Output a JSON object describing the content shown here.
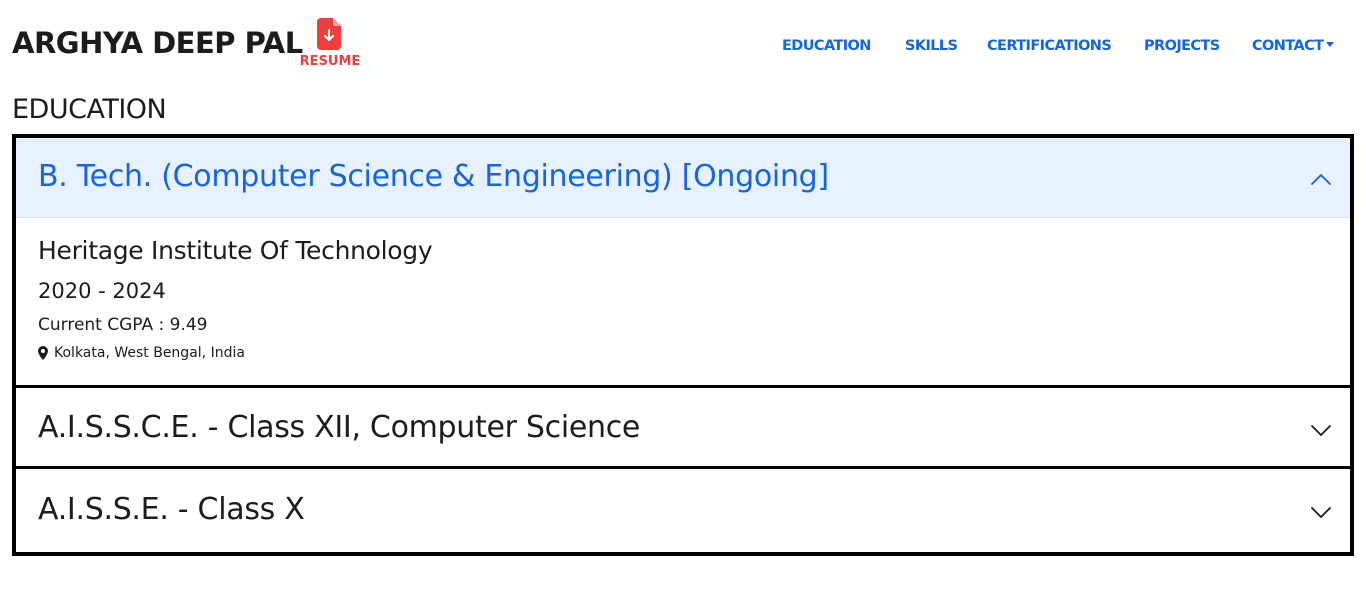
{
  "header": {
    "brand": "ARGHYA DEEP PAL",
    "resume_label": "RESUME",
    "nav": [
      "EDUCATION",
      "SKILLS",
      "CERTIFICATIONS",
      "PROJECTS",
      "CONTACT"
    ]
  },
  "section_title": "EDUCATION",
  "accordion": {
    "items": [
      {
        "title": "B. Tech. (Computer Science & Engineering) [Ongoing]",
        "expanded": true,
        "institute": "Heritage Institute Of Technology",
        "years": "2020 - 2024",
        "score": "Current CGPA : 9.49",
        "location": "Kolkata, West Bengal, India"
      },
      {
        "title": "A.I.S.S.C.E. - Class XII, Computer Science",
        "expanded": false
      },
      {
        "title": "A.I.S.S.E. - Class X",
        "expanded": false
      }
    ]
  },
  "colors": {
    "accent": "#1565e0",
    "resume_red": "#f03e3e",
    "expanded_bg": "#e7f1ff"
  },
  "icons": [
    "file-download-icon",
    "caret-down-icon",
    "chevron-up-icon",
    "map-marker-icon",
    "chevron-down-icon"
  ]
}
